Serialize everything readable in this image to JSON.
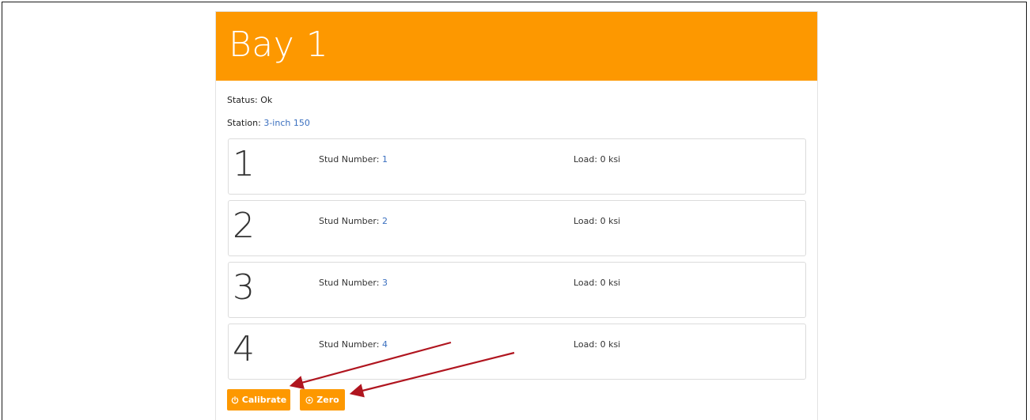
{
  "bay": {
    "title": "Bay 1",
    "status_label": "Status:",
    "status_value": "Ok",
    "station_label": "Station:",
    "station_value": "3-inch 150"
  },
  "studs": [
    {
      "index": "1",
      "stud_label": "Stud Number:",
      "stud_number": "1",
      "load_text": "Load: 0 ksi"
    },
    {
      "index": "2",
      "stud_label": "Stud Number:",
      "stud_number": "2",
      "load_text": "Load: 0 ksi"
    },
    {
      "index": "3",
      "stud_label": "Stud Number:",
      "stud_number": "3",
      "load_text": "Load: 0 ksi"
    },
    {
      "index": "4",
      "stud_label": "Stud Number:",
      "stud_number": "4",
      "load_text": "Load: 0 ksi"
    }
  ],
  "buttons": {
    "calibrate_label": "Calibrate",
    "calibrate_icon": "power-icon",
    "zero_label": "Zero",
    "zero_icon": "target-circle-icon"
  },
  "colors": {
    "accent": "#fd9800",
    "link": "#3a6fbf",
    "annotation_arrow": "#b0151f"
  }
}
